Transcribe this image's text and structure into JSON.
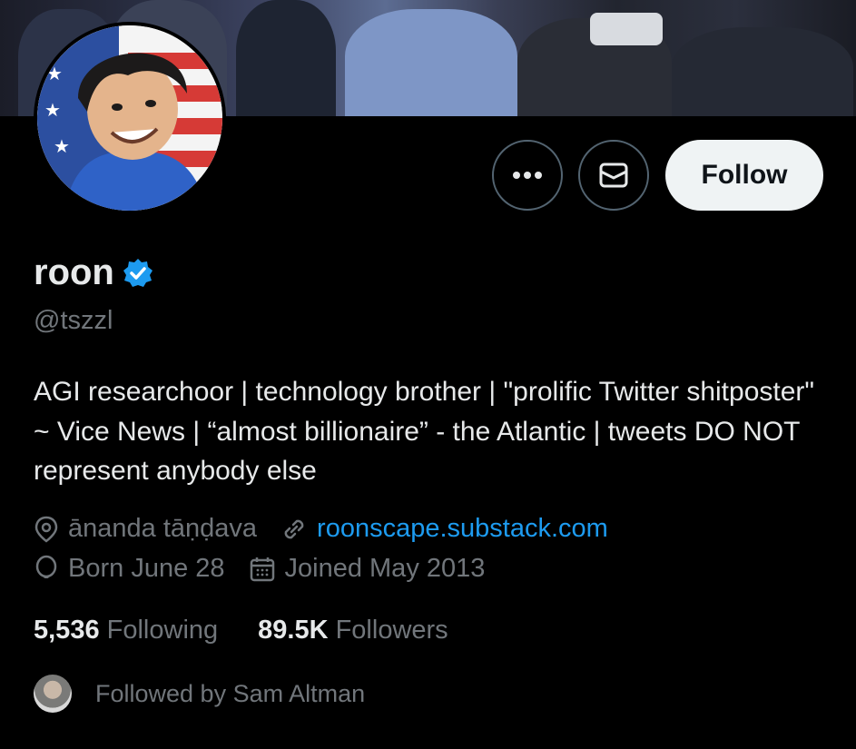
{
  "profile": {
    "name": "roon",
    "handle": "@tszzl",
    "bio": "AGI researchoor | technology brother | \"prolific Twitter shitposter\" ~ Vice News | “almost billionaire” - the Atlantic | tweets DO NOT represent anybody else",
    "location": "ānanda tāṇḍava",
    "website": "roonscape.substack.com",
    "birthday": "Born June 28",
    "joined": "Joined May 2013"
  },
  "actions": {
    "more_icon": "more-dots-icon",
    "message_icon": "envelope-icon",
    "follow_label": "Follow"
  },
  "stats": {
    "following_count": "5,536",
    "following_label": "Following",
    "followers_count": "89.5K",
    "followers_label": "Followers"
  },
  "followed_by": {
    "text": "Followed by Sam Altman"
  },
  "colors": {
    "background": "#000000",
    "text_primary": "#e7e9ea",
    "text_secondary": "#71767b",
    "link": "#1d9bf0",
    "verified": "#1d9bf0",
    "follow_button_bg": "#eff3f4"
  }
}
